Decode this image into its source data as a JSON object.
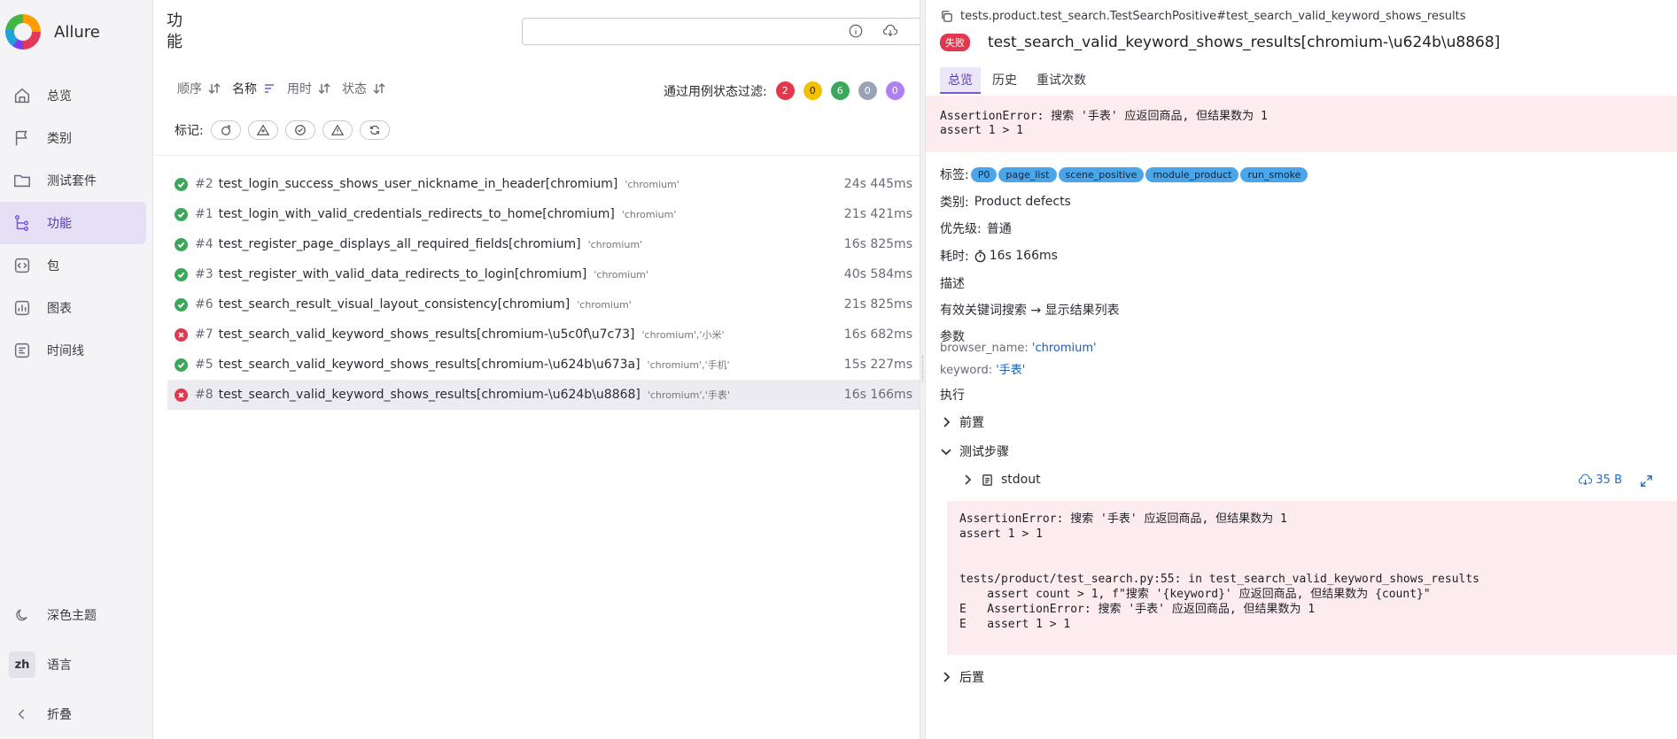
{
  "app": {
    "name": "Allure"
  },
  "sidebar": {
    "items": [
      {
        "label": "总览",
        "icon": "home-icon"
      },
      {
        "label": "类别",
        "icon": "flag-icon"
      },
      {
        "label": "测试套件",
        "icon": "folder-icon"
      },
      {
        "label": "功能",
        "icon": "feature-tree-icon",
        "active": true
      },
      {
        "label": "包",
        "icon": "package-icon"
      },
      {
        "label": "图表",
        "icon": "chart-icon"
      },
      {
        "label": "时间线",
        "icon": "timeline-icon"
      }
    ],
    "theme_label": "深色主题",
    "lang_code": "zh",
    "lang_label": "语言",
    "collapse_label": "折叠"
  },
  "middle": {
    "title": "功能",
    "search_value": "",
    "sort": {
      "order": "顺序",
      "name": "名称",
      "duration": "用时",
      "status": "状态"
    },
    "status_filter_label": "通过用例状态过滤:",
    "status_counts": [
      {
        "value": "2",
        "color": "#e1384f"
      },
      {
        "value": "0",
        "color": "#f2c200"
      },
      {
        "value": "6",
        "color": "#3aa75b"
      },
      {
        "value": "0",
        "color": "#9aa3b5"
      },
      {
        "value": "0",
        "color": "#b07ff2"
      }
    ],
    "marks_label": "标记:",
    "tests": [
      {
        "status": "passed",
        "num": "#2",
        "name": "test_login_success_shows_user_nickname_in_header[chromium]",
        "params": "'chromium'",
        "duration": "24s 445ms"
      },
      {
        "status": "passed",
        "num": "#1",
        "name": "test_login_with_valid_credentials_redirects_to_home[chromium]",
        "params": "'chromium'",
        "duration": "21s 421ms"
      },
      {
        "status": "passed",
        "num": "#4",
        "name": "test_register_page_displays_all_required_fields[chromium]",
        "params": "'chromium'",
        "duration": "16s 825ms"
      },
      {
        "status": "passed",
        "num": "#3",
        "name": "test_register_with_valid_data_redirects_to_login[chromium]",
        "params": "'chromium'",
        "duration": "40s 584ms"
      },
      {
        "status": "passed",
        "num": "#6",
        "name": "test_search_result_visual_layout_consistency[chromium]",
        "params": "'chromium'",
        "duration": "21s 825ms"
      },
      {
        "status": "failed",
        "num": "#7",
        "name": "test_search_valid_keyword_shows_results[chromium-\\u5c0f\\u7c73]",
        "params": "'chromium','小米'",
        "duration": "16s 682ms"
      },
      {
        "status": "passed",
        "num": "#5",
        "name": "test_search_valid_keyword_shows_results[chromium-\\u624b\\u673a]",
        "params": "'chromium','手机'",
        "duration": "15s 227ms"
      },
      {
        "status": "failed",
        "num": "#8",
        "name": "test_search_valid_keyword_shows_results[chromium-\\u624b\\u8868]",
        "params": "'chromium','手表'",
        "duration": "16s 166ms",
        "selected": true
      }
    ]
  },
  "detail": {
    "path": "tests.product.test_search.TestSearchPositive#test_search_valid_keyword_shows_results",
    "status_badge": "失败",
    "title": "test_search_valid_keyword_shows_results[chromium-\\u624b\\u8868]",
    "tabs": [
      "总览",
      "历史",
      "重试次数"
    ],
    "error_message": "AssertionError: 搜索 '手表' 应返回商品, 但结果数为 1\nassert 1 > 1",
    "tags_label": "标签:",
    "tags": [
      "P0",
      "page_list",
      "scene_positive",
      "module_product",
      "run_smoke"
    ],
    "category_label": "类别:",
    "category_value": "Product defects",
    "severity_label": "优先级:",
    "severity_value": "普通",
    "duration_label": "耗时:",
    "duration_value": "16s 166ms",
    "description_heading": "描述",
    "description_text": "有效关键词搜索 → 显示结果列表",
    "params_heading": "参数",
    "params": [
      {
        "key": "browser_name:",
        "value": "'chromium'"
      },
      {
        "key": "keyword:",
        "value": "'手表'"
      }
    ],
    "execution_heading": "执行",
    "setup_label": "前置",
    "steps_label": "测试步骤",
    "stdout_label": "stdout",
    "stdout_size": "35 B",
    "trace": "AssertionError: 搜索 '手表' 应返回商品, 但结果数为 1\nassert 1 > 1\n\n\ntests/product/test_search.py:55: in test_search_valid_keyword_shows_results\n    assert count > 1, f\"搜索 '{keyword}' 应返回商品, 但结果数为 {count}\"\nE   AssertionError: 搜索 '手表' 应返回商品, 但结果数为 1\nE   assert 1 > 1",
    "teardown_label": "后置"
  }
}
